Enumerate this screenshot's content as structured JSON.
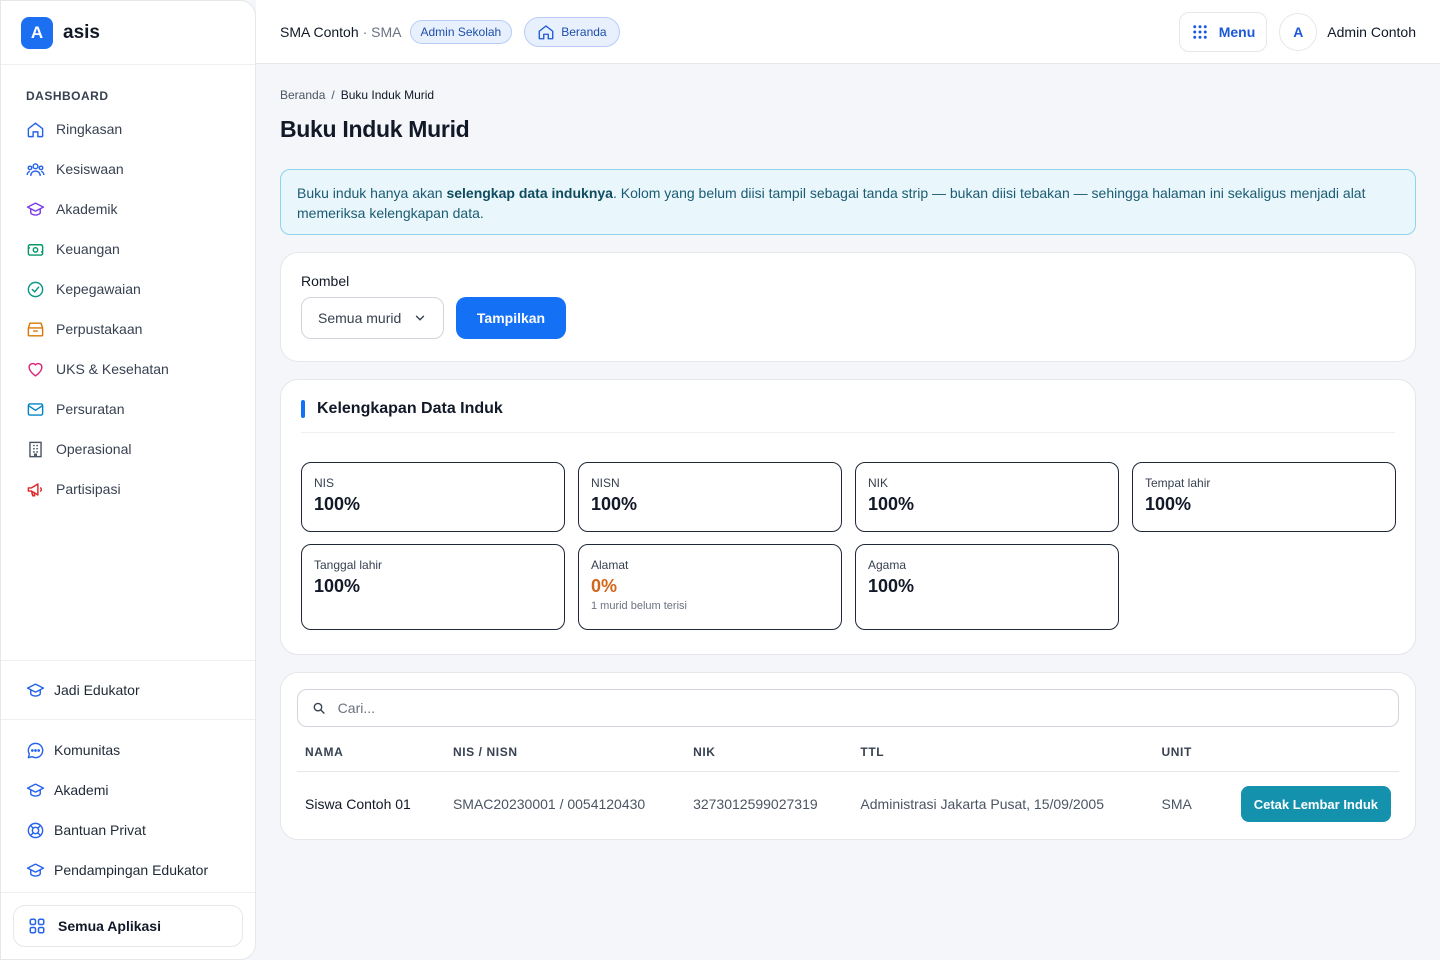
{
  "brand": {
    "logo_letter": "A",
    "name": "asis"
  },
  "sidebar": {
    "section_label": "DASHBOARD",
    "items": [
      {
        "label": "Ringkasan",
        "icon": "home-icon",
        "color": "#2563eb"
      },
      {
        "label": "Kesiswaan",
        "icon": "users-icon",
        "color": "#2563eb"
      },
      {
        "label": "Akademik",
        "icon": "graduation-cap-icon",
        "color": "#7c3aed"
      },
      {
        "label": "Keuangan",
        "icon": "money-icon",
        "color": "#059669"
      },
      {
        "label": "Kepegawaian",
        "icon": "badge-check-icon",
        "color": "#0d9488"
      },
      {
        "label": "Perpustakaan",
        "icon": "archive-icon",
        "color": "#d97706"
      },
      {
        "label": "UKS & Kesehatan",
        "icon": "heart-icon",
        "color": "#db2777"
      },
      {
        "label": "Persuratan",
        "icon": "mail-icon",
        "color": "#0284c7"
      },
      {
        "label": "Operasional",
        "icon": "building-icon",
        "color": "#4b5563"
      },
      {
        "label": "Partisipasi",
        "icon": "megaphone-icon",
        "color": "#dc2626"
      }
    ],
    "bottom_primary": {
      "label": "Jadi Edukator",
      "icon": "graduation-cap-icon"
    },
    "bottom_items": [
      {
        "label": "Komunitas",
        "icon": "chat-icon"
      },
      {
        "label": "Akademi",
        "icon": "graduation-cap-icon"
      },
      {
        "label": "Bantuan Privat",
        "icon": "lifebuoy-icon"
      },
      {
        "label": "Pendampingan Edukator",
        "icon": "graduation-cap-icon"
      }
    ],
    "all_apps_label": "Semua Aplikasi"
  },
  "topbar": {
    "school_name": "SMA Contoh",
    "school_type": "· SMA",
    "role_badge": "Admin Sekolah",
    "home_pill": "Beranda",
    "menu_label": "Menu",
    "avatar_letter": "A",
    "user_name": "Admin Contoh"
  },
  "breadcrumb": {
    "home": "Beranda",
    "separator": "/",
    "current": "Buku Induk Murid"
  },
  "page_title": "Buku Induk Murid",
  "info": {
    "before": "Buku induk hanya akan ",
    "bold": "selengkap data induknya",
    "after": ". Kolom yang belum diisi tampil sebagai tanda strip — bukan diisi tebakan — sehingga halaman ini sekaligus menjadi alat memeriksa kelengkapan data."
  },
  "filter": {
    "label": "Rombel",
    "select_value": "Semua murid",
    "submit_label": "Tampilkan"
  },
  "completeness": {
    "title": "Kelengkapan Data Induk",
    "stats": [
      {
        "label": "NIS",
        "value": "100%",
        "note": ""
      },
      {
        "label": "NISN",
        "value": "100%",
        "note": ""
      },
      {
        "label": "NIK",
        "value": "100%",
        "note": ""
      },
      {
        "label": "Tempat lahir",
        "value": "100%",
        "note": ""
      },
      {
        "label": "Tanggal lahir",
        "value": "100%",
        "note": ""
      },
      {
        "label": "Alamat",
        "value": "0%",
        "note": "1 murid belum terisi",
        "warn": true
      },
      {
        "label": "Agama",
        "value": "100%",
        "note": ""
      }
    ]
  },
  "table": {
    "search_placeholder": "Cari...",
    "columns": [
      "NAMA",
      "NIS / NISN",
      "NIK",
      "TTL",
      "UNIT",
      ""
    ],
    "rows": [
      {
        "nama": "Siswa Contoh 01",
        "nis_nisn": "SMAC20230001 / 0054120430",
        "nik": "3273012599027319",
        "ttl": "Administrasi Jakarta Pusat, 15/09/2005",
        "unit": "SMA",
        "action": "Cetak Lembar Induk"
      }
    ]
  },
  "colors": {
    "primary": "#1470f5",
    "accent_teal": "#1491ad",
    "warn": "#d2661b",
    "info_bg": "#e9f6fb"
  }
}
